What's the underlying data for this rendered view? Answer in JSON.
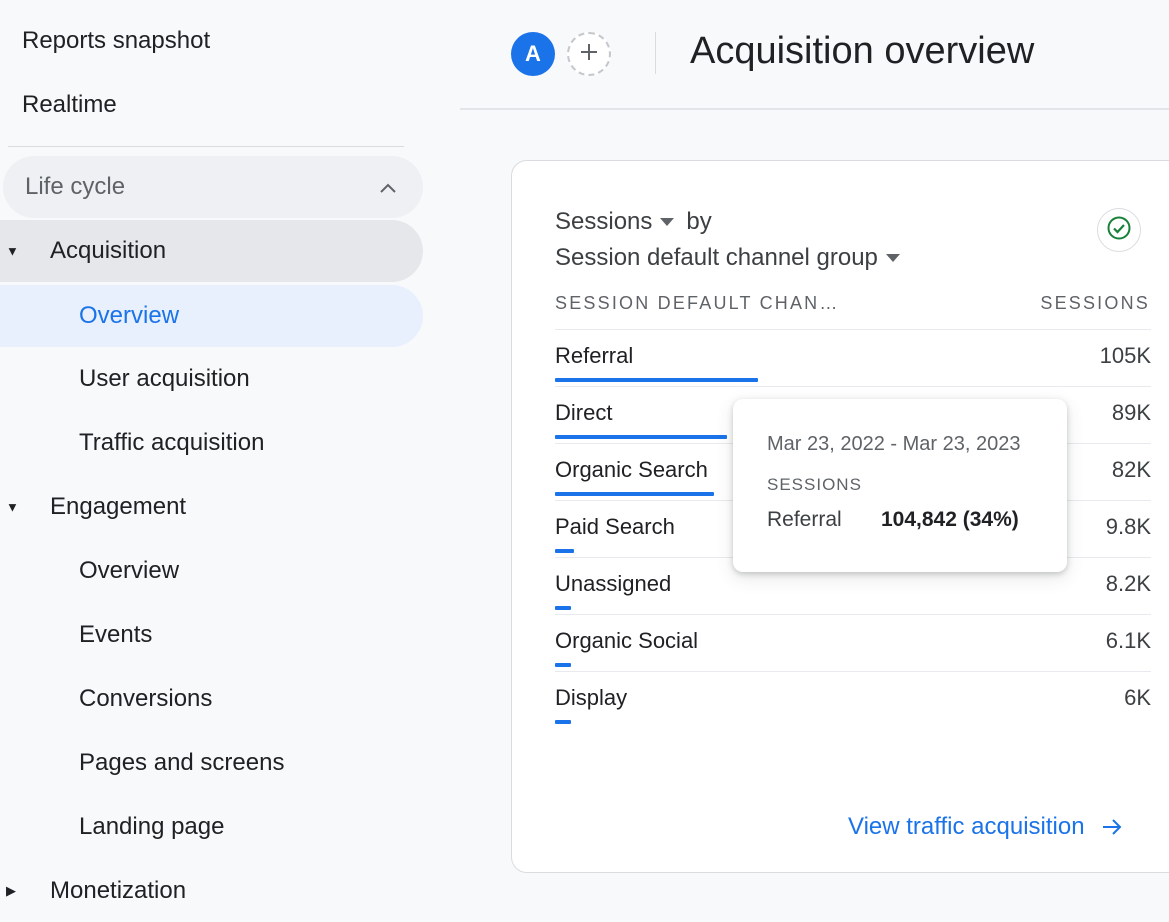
{
  "sidebar": {
    "top_items": [
      "Reports snapshot",
      "Realtime"
    ],
    "section_label": "Life cycle",
    "acquisition": {
      "label": "Acquisition",
      "children": [
        "Overview",
        "User acquisition",
        "Traffic acquisition"
      ]
    },
    "engagement": {
      "label": "Engagement",
      "children": [
        "Overview",
        "Events",
        "Conversions",
        "Pages and screens",
        "Landing page"
      ]
    },
    "monetization": {
      "label": "Monetization"
    }
  },
  "header": {
    "avatar_letter": "A",
    "title": "Acquisition overview"
  },
  "card": {
    "metric": "Sessions",
    "by": "by",
    "dimension": "Session default channel group",
    "col_dimension": "SESSION DEFAULT CHAN…",
    "col_metric": "SESSIONS",
    "rows": [
      {
        "label": "Referral",
        "value": "105K",
        "sessions": 104842
      },
      {
        "label": "Direct",
        "value": "89K",
        "sessions": 89000
      },
      {
        "label": "Organic Search",
        "value": "82K",
        "sessions": 82000
      },
      {
        "label": "Paid Search",
        "value": "9.8K",
        "sessions": 9800
      },
      {
        "label": "Unassigned",
        "value": "8.2K",
        "sessions": 8200
      },
      {
        "label": "Organic Social",
        "value": "6.1K",
        "sessions": 6100
      },
      {
        "label": "Display",
        "value": "6K",
        "sessions": 6000
      }
    ],
    "view_link": "View traffic acquisition"
  },
  "tooltip": {
    "date_range": "Mar 23, 2022 - Mar 23, 2023",
    "metric": "SESSIONS",
    "name": "Referral",
    "value": "104,842 (34%)"
  },
  "colors": {
    "accent": "#1a73e8",
    "selected_bg": "#e8f0fe",
    "check": "#188038"
  }
}
